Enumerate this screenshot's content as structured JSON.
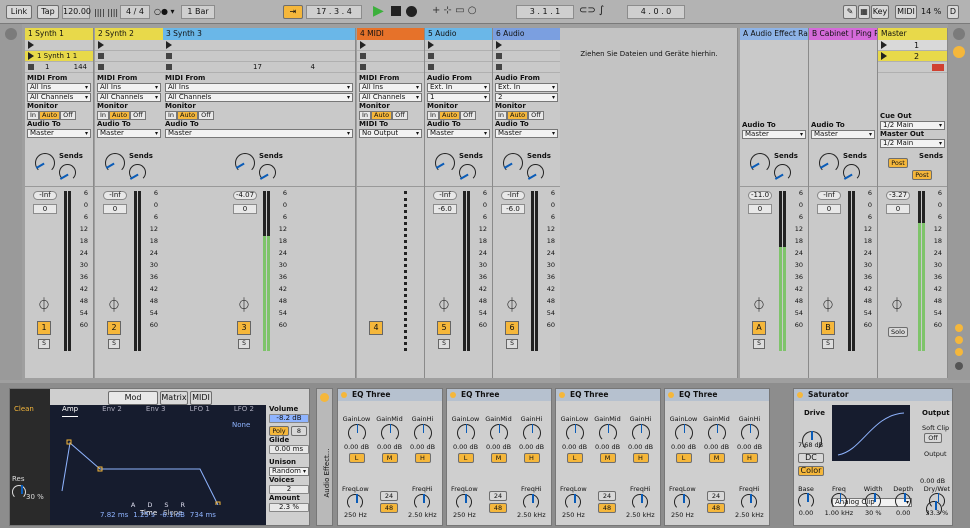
{
  "transport": {
    "link": "Link",
    "tap": "Tap",
    "tempo": "120.00",
    "sig": "4 / 4",
    "quant": "1 Bar",
    "pos": "17 . 3 . 4",
    "loop_start": "3 . 1 . 1",
    "loop_len": "4 . 0 . 0",
    "key": "Key",
    "midi": "MIDI",
    "cpu": "14 %",
    "d": "D"
  },
  "tracks": [
    {
      "name": "1 Synth 1",
      "color": "#e8d94a",
      "clip": "1 Synth 1 1",
      "a": "1",
      "b": "144",
      "midi_from": "MIDI From",
      "from": "All Ins",
      "ch": "All Channels",
      "mon": "Monitor",
      "to_lbl": "Audio To",
      "to": "Master",
      "vol": "-Inf",
      "pan": "0",
      "num": "1"
    },
    {
      "name": "2 Synth 2",
      "color": "#e8d94a",
      "clip": "",
      "midi_from": "MIDI From",
      "from": "All Ins",
      "ch": "All Channels",
      "mon": "Monitor",
      "to_lbl": "Audio To",
      "to": "Master",
      "vol": "-Inf",
      "pan": "0",
      "num": "2"
    },
    {
      "name": "3 Synth 3",
      "color": "#6ab7e8",
      "clip": "",
      "a": "17",
      "b": "4",
      "midi_from": "MIDI From",
      "from": "All Ins",
      "ch": "All Channels",
      "mon": "Monitor",
      "to_lbl": "Audio To",
      "to": "Master",
      "vol": "-4.07",
      "pan": "0",
      "num": "3"
    },
    {
      "name": "4 MIDI",
      "color": "#e6722a",
      "midi_from": "MIDI From",
      "from": "All Ins",
      "ch": "All Channels",
      "mon": "Monitor",
      "to_lbl": "MIDI To",
      "to": "No Output",
      "num": "4"
    },
    {
      "name": "5 Audio",
      "color": "#6ab7e8",
      "midi_from": "Audio From",
      "from": "Ext. In",
      "ch": "1",
      "mon": "Monitor",
      "to_lbl": "Audio To",
      "to": "Master",
      "vol": "-Inf",
      "pan": "-6.0",
      "num": "5"
    },
    {
      "name": "6 Audio",
      "color": "#7b9fe0",
      "midi_from": "Audio From",
      "from": "Ext. In",
      "ch": "2",
      "mon": "Monitor",
      "to_lbl": "Audio To",
      "to": "Master",
      "vol": "-Inf",
      "pan": "-6.0",
      "num": "6"
    }
  ],
  "drop_hint": "Ziehen Sie Dateien und Geräte hierhin.",
  "returns": [
    {
      "name": "A Audio Effect Rac",
      "color": "#8eb3e6",
      "to_lbl": "Audio To",
      "to": "Master",
      "vol": "-11.0",
      "pan": "0",
      "num": "A"
    },
    {
      "name": "B Cabinet | Ping P",
      "color": "#d46ad9",
      "to_lbl": "Audio To",
      "to": "Master",
      "vol": "-Inf",
      "pan": "0",
      "num": "B"
    }
  ],
  "master": {
    "name": "Master",
    "color": "#e8d94a",
    "s1": "1",
    "s2": "2",
    "cue": "Cue Out",
    "cue_v": "1/2 Main",
    "mout": "Master Out",
    "mout_v": "1/2 Main",
    "vol": "-3.27",
    "pan": "0",
    "post": "Post",
    "solo": "Solo"
  },
  "sends": "Sends",
  "mon_in": "In",
  "mon_auto": "Auto",
  "mon_off": "Off",
  "scale": [
    "6",
    "0",
    "6",
    "12",
    "18",
    "24",
    "30",
    "36",
    "42",
    "48",
    "54",
    "60"
  ],
  "synth": {
    "preset": "Clean",
    "tabs": [
      "Mod Sources",
      "Matrix",
      "MIDI"
    ],
    "env_tabs": [
      "Amp",
      "Env 2",
      "Env 3",
      "LFO 1",
      "LFO 2"
    ],
    "none": "None",
    "time": "Time",
    "slope": "Slope",
    "adsr": [
      "A",
      "D",
      "S",
      "R"
    ],
    "adsr_v": [
      "7.82 ms",
      "1.25 s",
      "-6.1 dB",
      "734 ms"
    ],
    "res": "Res",
    "res_v": "30 %",
    "volume": "Volume",
    "volume_v": "-8.2 dB",
    "poly": "Poly",
    "poly_n": "8",
    "glide": "Glide",
    "glide_v": "0.00 ms",
    "unison": "Unison",
    "unison_v": "Random",
    "voices": "Voices",
    "voices_v": "2",
    "amount": "Amount",
    "amount_v": "2.3 %"
  },
  "rack_label": "Audio Effect...",
  "eq": {
    "title": "EQ Three",
    "low": "GainLow",
    "mid": "GainMid",
    "hi": "GainHi",
    "val": "0.00 dB",
    "L": "L",
    "M": "M",
    "H": "H",
    "flo": "FreqLow",
    "fhi": "FreqHi",
    "flo_v": "250 Hz",
    "fhi_v": "2.50 kHz",
    "n1": "24",
    "n2": "48"
  },
  "sat": {
    "title": "Saturator",
    "drive": "Drive",
    "drive_v": "7.68 dB",
    "dc": "DC",
    "color": "Color",
    "mode": "Analog Clip",
    "output": "Output",
    "soft": "Soft Clip",
    "soft_v": "Off",
    "out_lbl": "Output",
    "out_v": "0.00 dB",
    "base": "Base",
    "base_v": "0.00",
    "freq": "Freq",
    "freq_v": "1.00 kHz",
    "width": "Width",
    "width_v": "30 %",
    "depth": "Depth",
    "depth_v": "0.00",
    "dw": "Dry/Wet",
    "dw_v": "33.3 %"
  }
}
